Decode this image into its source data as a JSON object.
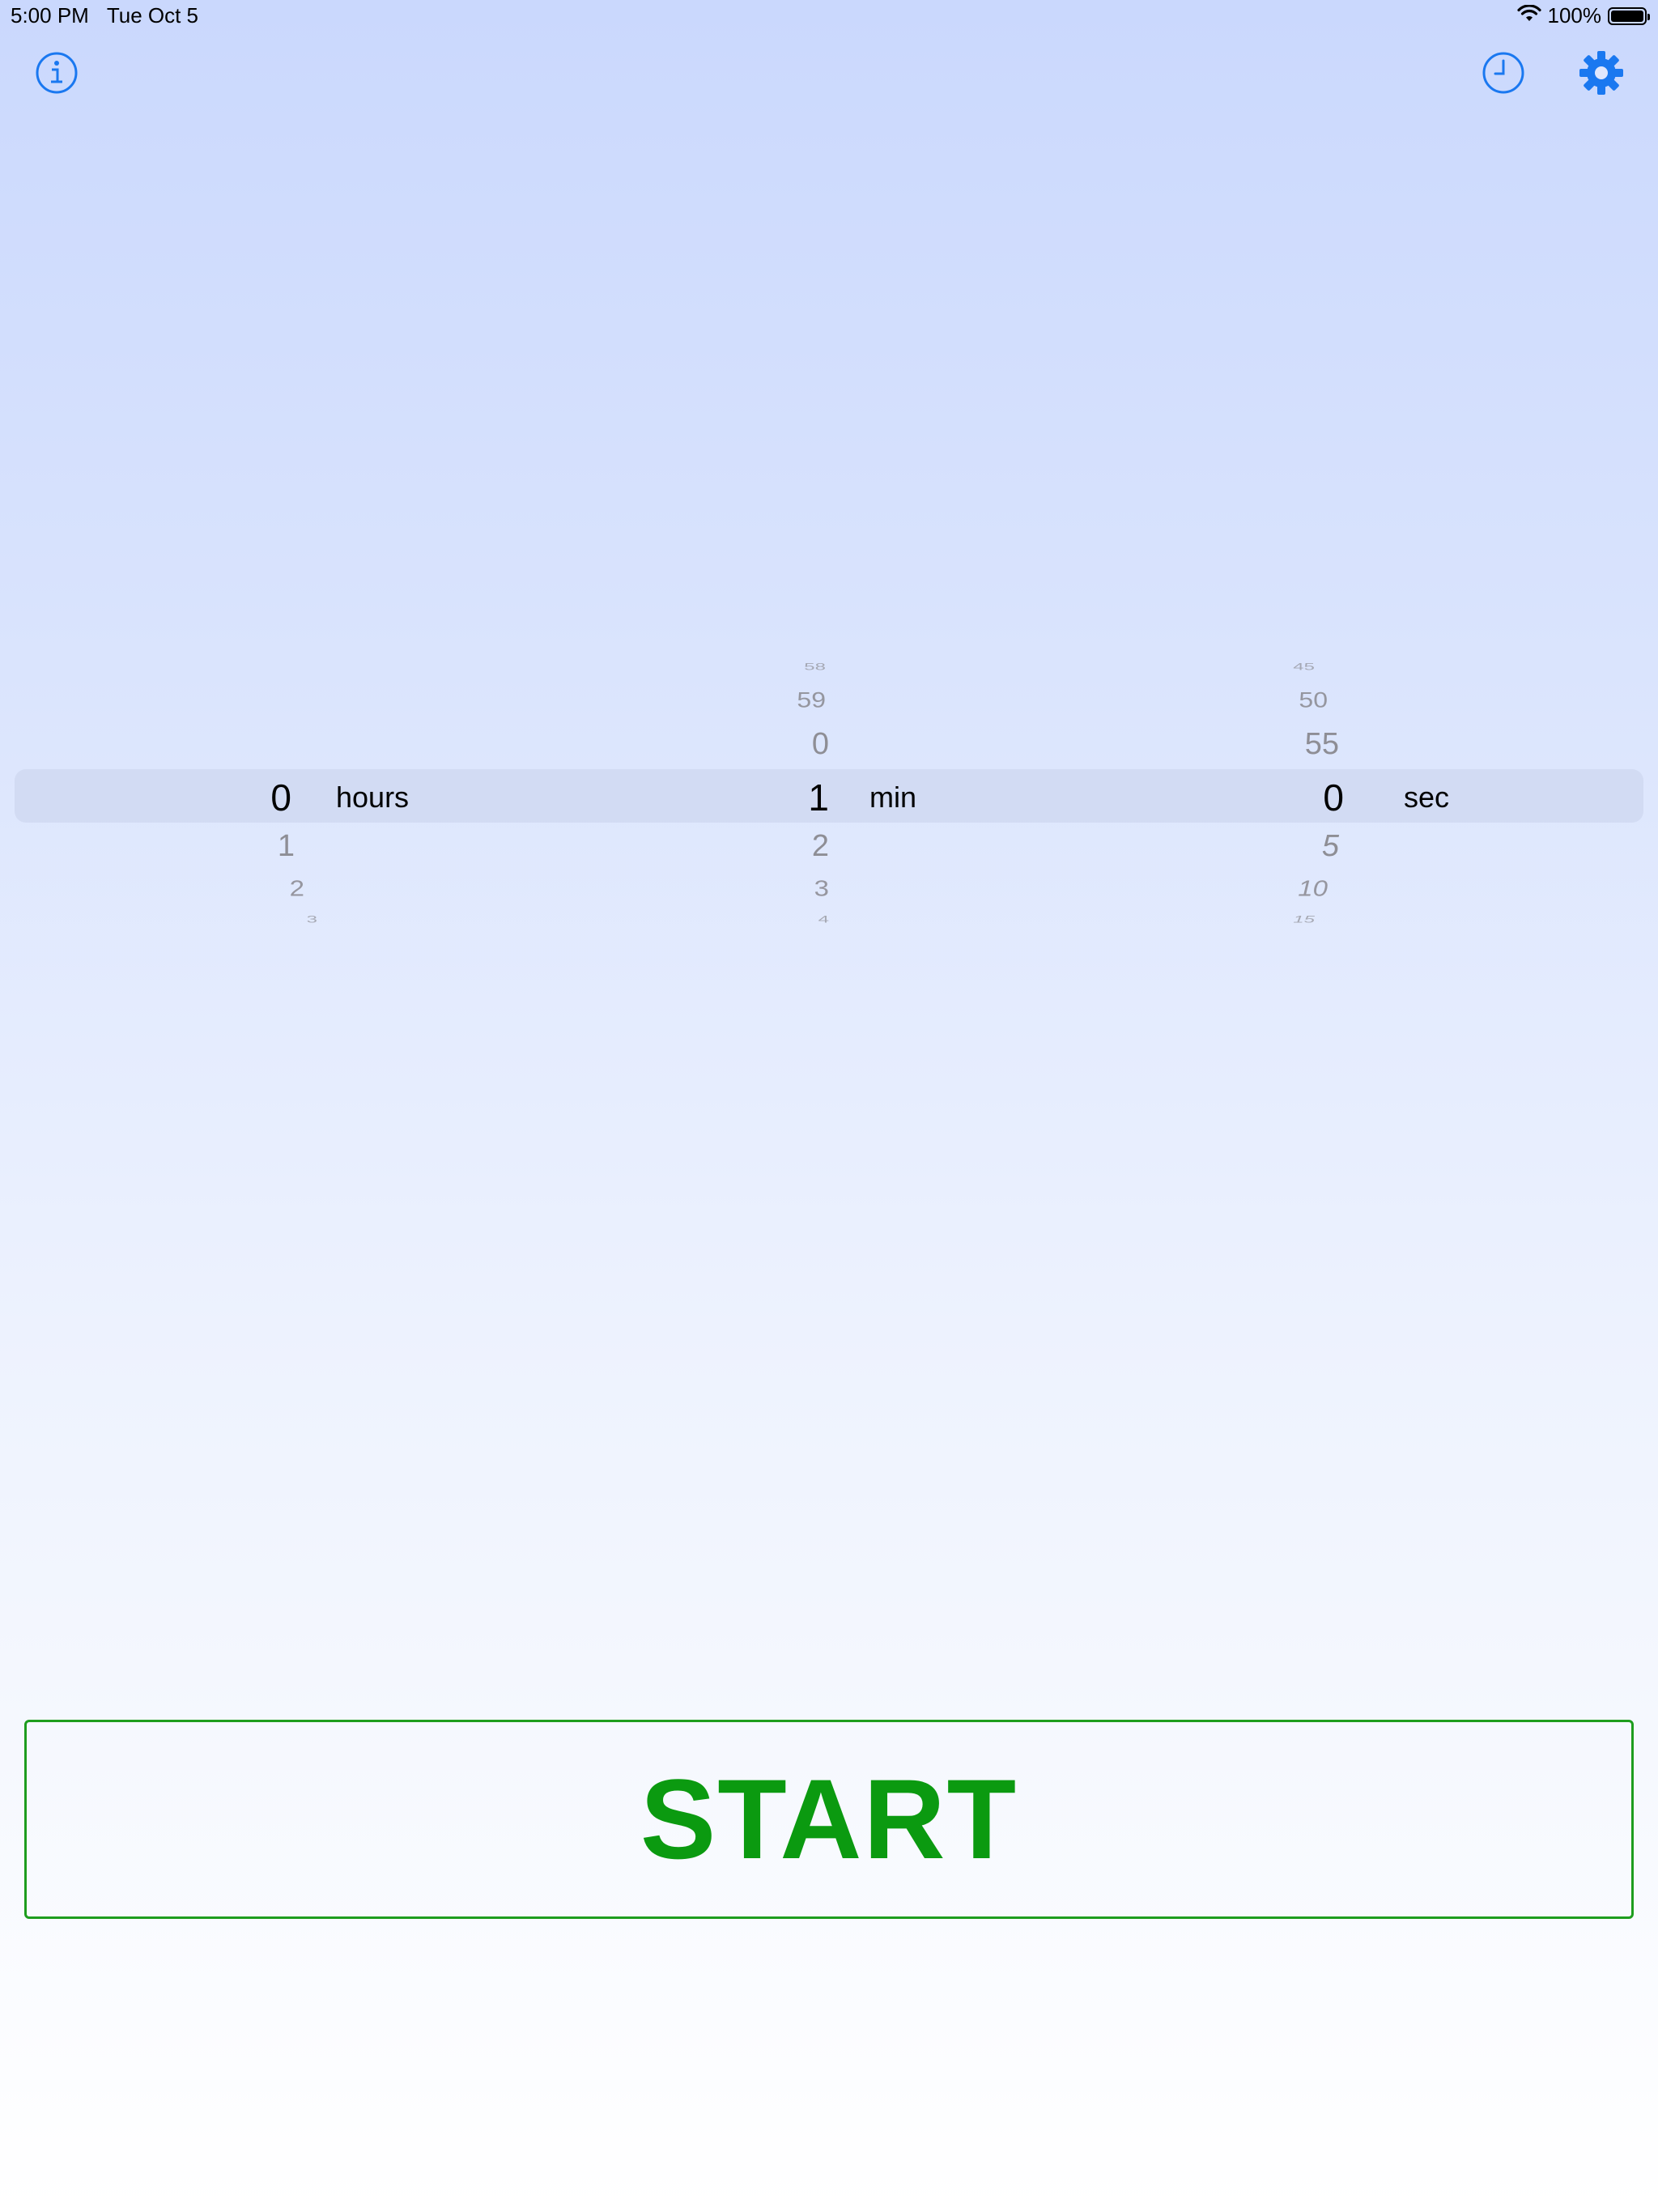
{
  "status_bar": {
    "time": "5:00 PM",
    "date": "Tue Oct 5",
    "battery_text": "100%",
    "battery_level": 1.0
  },
  "toolbar": {
    "info_icon": "info-circle-icon",
    "history_icon": "clock-icon",
    "settings_icon": "gear-icon",
    "accent_color": "#1a78f0"
  },
  "picker": {
    "hours": {
      "above": [],
      "selected": "0",
      "unit": "hours",
      "below": [
        "1",
        "2",
        "3"
      ]
    },
    "minutes": {
      "above": [
        "58",
        "59",
        "0"
      ],
      "selected": "1",
      "unit": "min",
      "below": [
        "2",
        "3",
        "4"
      ]
    },
    "seconds": {
      "above": [
        "45",
        "50",
        "55"
      ],
      "selected": "0",
      "unit": "sec",
      "below": [
        "5",
        "10",
        "15"
      ]
    }
  },
  "start_button": {
    "label": "START",
    "color": "#0b9a10"
  }
}
